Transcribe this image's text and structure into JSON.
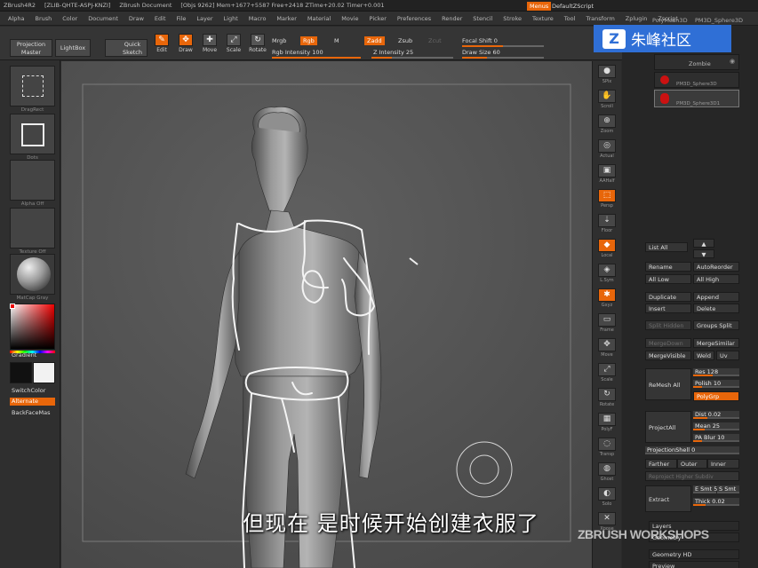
{
  "title_bar": {
    "app": "ZBrush4R2",
    "build": "[ZLIB-QHTE-ASPJ-KNZI]",
    "document": "ZBrush Document",
    "stats": "[Objs 9262] Mem+1677+5587 Free+2418 ZTime+20.02 Timer+0.001",
    "menus_button": "Menus",
    "default_script": "DefaultZScript"
  },
  "menu_bar": [
    "Alpha",
    "Brush",
    "Color",
    "Document",
    "Draw",
    "Edit",
    "File",
    "Layer",
    "Light",
    "Macro",
    "Marker",
    "Material",
    "Movie",
    "Picker",
    "Preferences",
    "Render",
    "Stencil",
    "Stroke",
    "Texture",
    "Tool",
    "Transform",
    "Zplugin",
    "Zscript"
  ],
  "toolbar": {
    "projection_master": "Projection Master",
    "lightbox": "LightBox",
    "quick_sketch": "Quick Sketch",
    "edit": "Edit",
    "draw": "Draw",
    "move": "Move",
    "scale": "Scale",
    "rotate": "Rotate",
    "mrgb": "Mrgb",
    "rgb": "Rgb",
    "m": "M",
    "zadd": "Zadd",
    "zsub": "Zsub",
    "zcut": "Zcut",
    "rgb_intensity": "Rgb Intensity 100",
    "z_intensity": "Z Intensity 25",
    "focal_shift": "Focal Shift 0",
    "draw_size": "Draw Size 60",
    "rgb_intensity_fraction": 1.0,
    "z_intensity_fraction": 0.25,
    "focal_shift_fraction": 0.5,
    "draw_size_fraction": 0.3
  },
  "left_shelf": {
    "thumb_captions": [
      "DragRect",
      "Dots",
      "Alpha Off",
      "Texture Off",
      "MatCap Gray"
    ],
    "gradient": "Gradient",
    "switch_color": "SwitchColor",
    "alternate": "Alternate",
    "backface_mask": "BackFaceMas"
  },
  "right_shelf": [
    "SPix",
    "Scroll",
    "Zoom",
    "Actual",
    "AAHalf",
    "Persp",
    "Floor",
    "Local",
    "L.Sym",
    "Gxyz",
    "Frame",
    "Move",
    "Scale",
    "Rotate",
    "PolyF",
    "Transp",
    "Ghost",
    "Solo",
    "Xpose"
  ],
  "subtools": {
    "header_left": "PolyMesh3D",
    "header_right": "PM3D_Sphere3D",
    "items": [
      "Zombie",
      "PM3D_Sphere3D",
      "PM3D_Sphere3D1"
    ]
  },
  "subtool_buttons": {
    "list_all": "List All",
    "rename": "Rename",
    "auto_reorder": "AutoReorder",
    "all_low": "All Low",
    "all_high": "All High",
    "duplicate": "Duplicate",
    "append": "Append",
    "insert": "Insert",
    "delete": "Delete",
    "split_hidden": "Split Hidden",
    "groups_split": "Groups Split",
    "merge_down": "MergeDown",
    "merge_similar": "MergeSimilar",
    "merge_visible": "MergeVisible",
    "weld": "Weld",
    "uv": "Uv",
    "remesh_all": "ReMesh All",
    "res": "Res 128",
    "polish": "Polish 10",
    "polygrp": "PolyGrp",
    "project_all": "ProjectAll",
    "dist": "Dist 0.02",
    "mean": "Mean 25",
    "pa_blur": "PA Blur 10",
    "projection_shell": "ProjectionShell 0",
    "farther": "Farther",
    "outer": "Outer",
    "inner": "Inner",
    "reproject_higher": "Reproject Higher Subdiv",
    "extract": "Extract",
    "e_smt": "E Smt 5",
    "s_smt": "S Smt",
    "thick": "Thick 0.02",
    "layers": "Layers",
    "geometry": "Geometry",
    "geometry_hd": "Geometry HD",
    "preview": "Preview"
  },
  "watermark": {
    "logo_letter": "Z",
    "text": "朱峰社区",
    "workshops": "ZBRUSH WORKSHOPS"
  },
  "subtitle": "但现在  是时候开始创建衣服了",
  "colors": {
    "accent": "#e8660a",
    "badge": "#2f6fd6",
    "background": "#2b2b2b",
    "canvas": "#555555"
  }
}
